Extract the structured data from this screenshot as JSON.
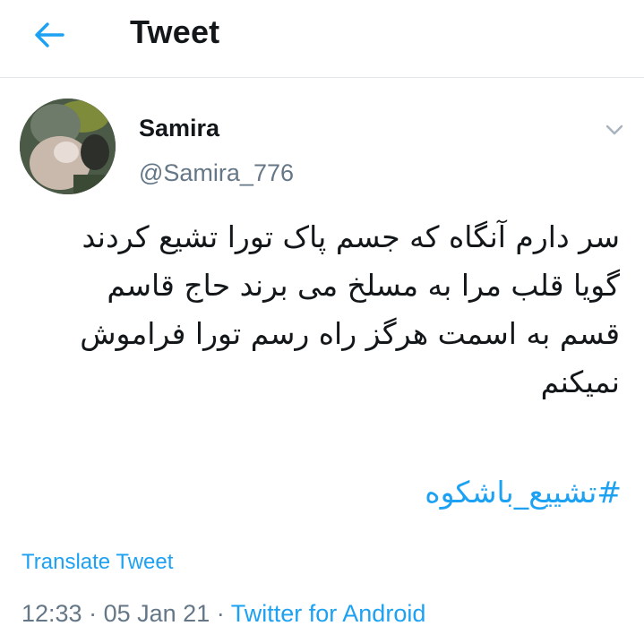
{
  "header": {
    "title": "Tweet",
    "back_icon": "back-arrow-icon"
  },
  "author": {
    "name": "Samira",
    "handle": "@Samira_776"
  },
  "tweet": {
    "text": "سر دارم آنگاه که جسم پاک تورا تشیع کردند\nگویا قلب مرا به مسلخ می برند حاج قاسم\nقسم به اسمت هرگز راه رسم تورا فراموش\nنمیکنم",
    "hashtag": "#تشییع_باشکوه",
    "translate_label": "Translate Tweet",
    "time": "12:33",
    "date": "05 Jan 21",
    "source": "Twitter for Android",
    "separator": "·"
  },
  "colors": {
    "accent": "#1da1f2",
    "secondary_text": "#657786",
    "divider": "#e1e8ed"
  }
}
